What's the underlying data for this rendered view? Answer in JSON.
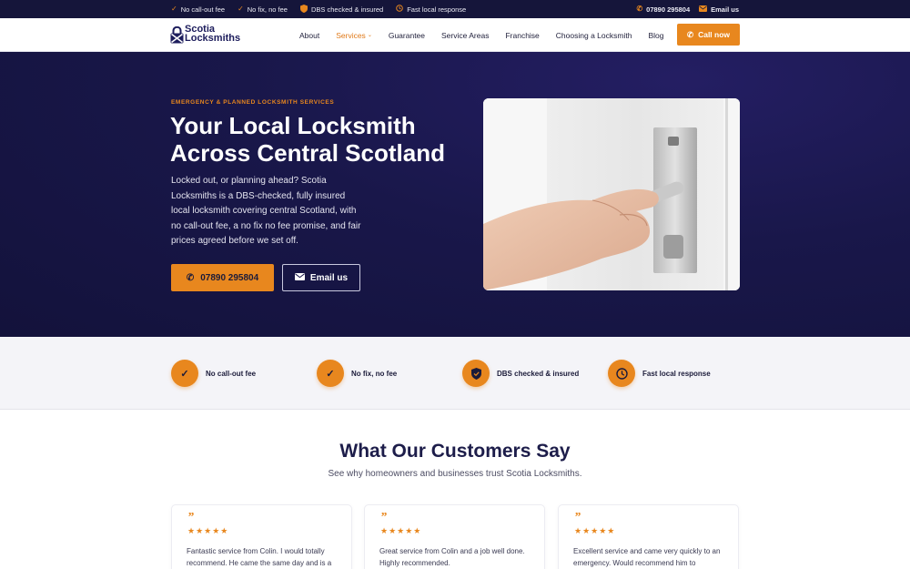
{
  "topbar": {
    "items": [
      {
        "icon": "check-icon",
        "label": "No call-out fee"
      },
      {
        "icon": "check-icon",
        "label": "No fix, no fee"
      },
      {
        "icon": "shield-icon",
        "label": "DBS checked & insured"
      },
      {
        "icon": "clock-icon",
        "label": "Fast local response"
      }
    ],
    "phone": "07890 295804",
    "email": "Email us"
  },
  "brand": {
    "line1": "Scotia",
    "line2": "Locksmiths"
  },
  "nav": {
    "items": [
      "About",
      "Services",
      "Guarantee",
      "Service Areas",
      "Franchise",
      "Choosing a Locksmith",
      "Blog"
    ],
    "active": "Services",
    "cta": "Call now"
  },
  "hero": {
    "eyebrow": "EMERGENCY & PLANNED LOCKSMITH SERVICES",
    "title_line1": "Your Local Locksmith",
    "title_line2": "Across Central Scotland",
    "lead": "Locked out, or planning ahead? Scotia Locksmiths is a DBS-checked, fully insured local locksmith covering central Scotland, with no call-out fee, a no fix no fee promise, and fair prices agreed before we set off.",
    "phone_button": "07890 295804",
    "email_button": "Email us"
  },
  "features": [
    {
      "icon": "check-icon",
      "label": "No call-out fee"
    },
    {
      "icon": "check-icon",
      "label": "No fix, no fee"
    },
    {
      "icon": "shield-icon",
      "label": "DBS checked & insured"
    },
    {
      "icon": "clock-icon",
      "label": "Fast local response"
    }
  ],
  "testimonials": {
    "title": "What Our Customers Say",
    "subtitle": "See why homeowners and businesses trust Scotia Locksmiths.",
    "quote_mark": "”",
    "stars": "★★★★★",
    "cards": [
      {
        "text": "Fantastic service from Colin. I would totally recommend. He came the same day and is a"
      },
      {
        "text": "Great service from Colin and a job well done. Highly recommended."
      },
      {
        "text": "Excellent service and came very quickly to an emergency. Would recommend him to"
      }
    ]
  },
  "colors": {
    "accent": "#e8871e",
    "navy": "#15153a",
    "hero": "#19174a"
  }
}
